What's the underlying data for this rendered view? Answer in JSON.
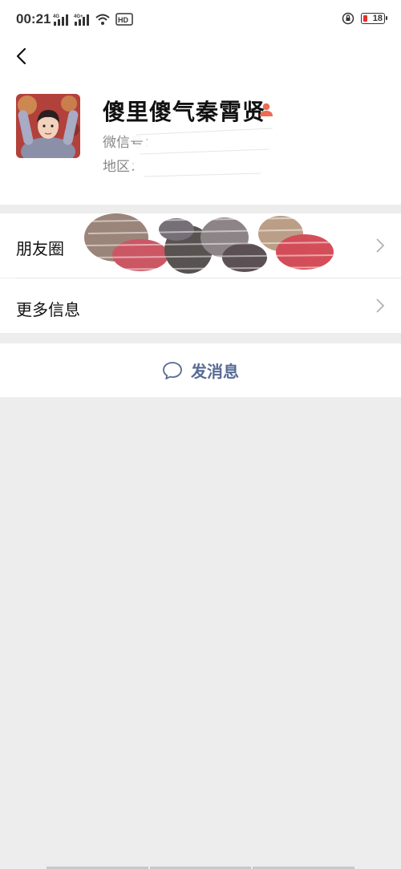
{
  "status_bar": {
    "time": "00:21",
    "signal1_label": "4G",
    "signal2_label": "4G+",
    "hd_label": "HD",
    "battery_level": "18",
    "battery_color": "#e0322e"
  },
  "header": {
    "back_icon": "chevron-left-icon"
  },
  "profile": {
    "name": "傻里傻气秦霄贤",
    "wechat_id_label": "微信号：",
    "region_label": "地区：",
    "gender_icon": "person-icon",
    "gender_icon_color": "#ec6b52"
  },
  "menu": {
    "items": [
      {
        "label": "朋友圈"
      },
      {
        "label": "更多信息"
      }
    ]
  },
  "actions": {
    "send_message_label": "发消息",
    "send_message_color": "#576b95"
  },
  "colors": {
    "page_background": "#ededed",
    "card_background": "#ffffff",
    "link_blue": "#576b95"
  }
}
